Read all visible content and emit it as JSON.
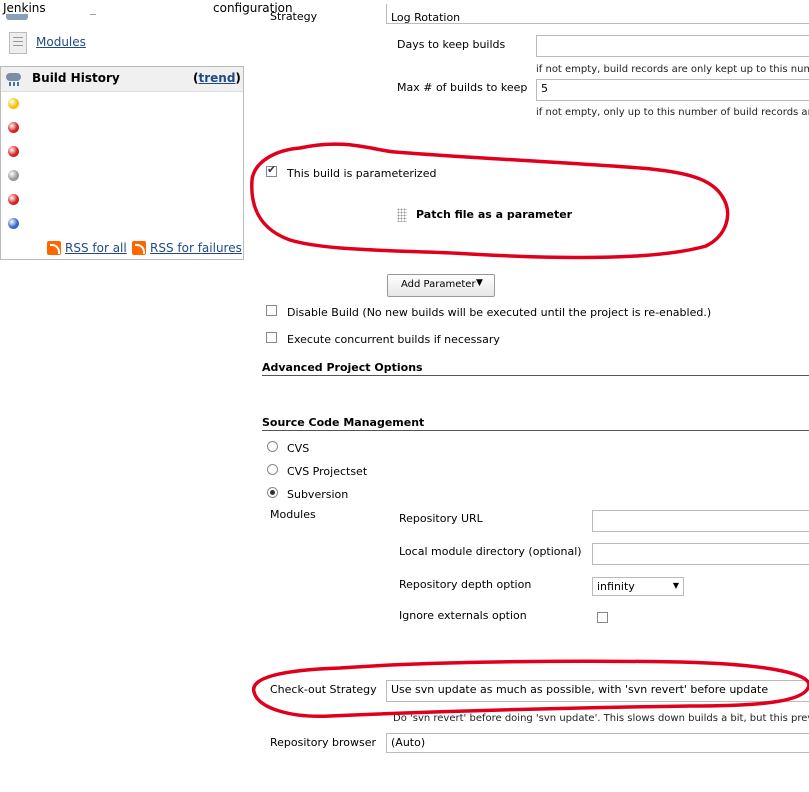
{
  "breadcrumbs": {
    "root": "Jenkins",
    "separator": "_",
    "current": "configuration"
  },
  "sidebar": {
    "modules_label": "Modules",
    "build_history": {
      "title": "Build History",
      "trend_label": "trend",
      "builds": [
        {
          "status": "yellow",
          "color": "#f2c300"
        },
        {
          "status": "red",
          "color": "#d62020"
        },
        {
          "status": "red",
          "color": "#d62020"
        },
        {
          "status": "gray",
          "color": "#999999"
        },
        {
          "status": "red",
          "color": "#d62020"
        },
        {
          "status": "blue",
          "color": "#3366cc"
        }
      ],
      "rss_all": "RSS for all",
      "rss_failures": "RSS for failures"
    }
  },
  "form": {
    "strategy_label": "Strategy",
    "strategy_value": "Log Rotation",
    "days_label": "Days to keep builds",
    "days_value": "",
    "days_hint": "if not empty, build records are only kept up to this num",
    "max_label": "Max # of builds to keep",
    "max_value": "5",
    "max_hint": "if not empty, only up to this number of build records are",
    "parameterized_label": "This build is parameterized",
    "parameter_name": "Patch file as a parameter",
    "add_parameter_label": "Add Parameter",
    "disable_label": "Disable Build (No new builds will be executed until the project is re-enabled.)",
    "concurrent_label": "Execute concurrent builds if necessary",
    "advanced_title": "Advanced Project Options",
    "scm_title": "Source Code Management",
    "scm_options": [
      "CVS",
      "CVS Projectset",
      "Subversion"
    ],
    "modules_title": "Modules",
    "repo_url_label": "Repository URL",
    "local_dir_label": "Local module directory (optional)",
    "depth_label": "Repository depth option",
    "depth_value": "infinity",
    "ignore_externals_label": "Ignore externals option",
    "checkout_label": "Check-out Strategy",
    "checkout_value": "Use svn update as much as possible, with 'svn revert' before update",
    "checkout_hint": "Do 'svn revert' before doing 'svn update'. This slows down builds a bit, but this prev",
    "browser_label": "Repository browser",
    "browser_value": "(Auto)"
  },
  "annotation_color": "#e0001b"
}
